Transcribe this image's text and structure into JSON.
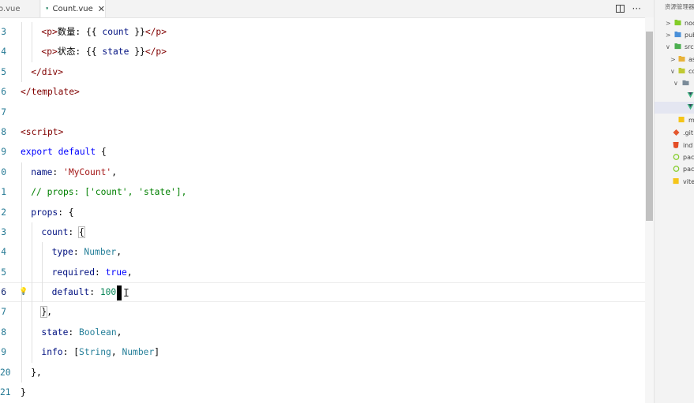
{
  "tabs": [
    {
      "label": "o.vue",
      "active": false
    },
    {
      "label": "Count.vue",
      "active": true
    }
  ],
  "tab_close_glyph": "✕",
  "tab_actions": {
    "split_icon": "split-editor-icon",
    "more_glyph": "···"
  },
  "colors": {
    "vue_green": "#41b883",
    "folder_yellow": "#e8b33b",
    "git_orange": "#e4572e",
    "html_orange": "#e44d26",
    "node_green": "#83cd29",
    "line_number": "#237893",
    "keyword_blue": "#0000ff",
    "string_red": "#a31515",
    "tag_maroon": "#800000"
  },
  "editor": {
    "lines": [
      {
        "n": "3",
        "parts": [
          [
            "t",
            "<p>"
          ],
          [
            "tpl",
            "数量: {{ "
          ],
          [
            "v",
            "count"
          ],
          [
            "tpl",
            " }}"
          ],
          [
            "t",
            "</p>"
          ]
        ]
      },
      {
        "n": "4",
        "parts": [
          [
            "t",
            "<p>"
          ],
          [
            "tpl",
            "状态: {{ "
          ],
          [
            "v",
            "state"
          ],
          [
            "tpl",
            " }}"
          ],
          [
            "t",
            "</p>"
          ]
        ]
      },
      {
        "n": "5",
        "parts": [
          [
            "t",
            "</div>"
          ]
        ]
      },
      {
        "n": "6",
        "parts": [
          [
            "t",
            "</template>"
          ]
        ]
      },
      {
        "n": "7",
        "parts": []
      },
      {
        "n": "8",
        "parts": [
          [
            "t",
            "<script>"
          ]
        ]
      },
      {
        "n": "9",
        "parts": [
          [
            "k",
            "export"
          ],
          [
            "pl",
            " "
          ],
          [
            "k",
            "default"
          ],
          [
            "pl",
            " {"
          ]
        ]
      },
      {
        "n": "0",
        "parts": [
          [
            "v",
            "name"
          ],
          [
            "pl",
            ": "
          ],
          [
            "s",
            "'MyCount'"
          ],
          [
            "pl",
            ","
          ]
        ]
      },
      {
        "n": "1",
        "parts": [
          [
            "c",
            "// props: ['count', 'state'],"
          ]
        ]
      },
      {
        "n": "2",
        "parts": [
          [
            "v",
            "props"
          ],
          [
            "pl",
            ": {"
          ]
        ]
      },
      {
        "n": "3",
        "parts": [
          [
            "v",
            "count"
          ],
          [
            "pl",
            ": "
          ],
          [
            "bb",
            "{"
          ]
        ]
      },
      {
        "n": "4",
        "parts": [
          [
            "v",
            "type"
          ],
          [
            "pl",
            ": "
          ],
          [
            "ty",
            "Number"
          ],
          [
            "pl",
            ","
          ]
        ]
      },
      {
        "n": "5",
        "parts": [
          [
            "v",
            "required"
          ],
          [
            "pl",
            ": "
          ],
          [
            "k",
            "true"
          ],
          [
            "pl",
            ","
          ]
        ]
      },
      {
        "n": "6",
        "parts": [
          [
            "v",
            "default"
          ],
          [
            "pl",
            ": "
          ],
          [
            "n",
            "100"
          ]
        ],
        "current": true
      },
      {
        "n": "7",
        "parts": [
          [
            "bb",
            "}"
          ],
          [
            "pl",
            ","
          ]
        ]
      },
      {
        "n": "8",
        "parts": [
          [
            "v",
            "state"
          ],
          [
            "pl",
            ": "
          ],
          [
            "ty",
            "Boolean"
          ],
          [
            "pl",
            ","
          ]
        ]
      },
      {
        "n": "9",
        "parts": [
          [
            "v",
            "info"
          ],
          [
            "pl",
            ": ["
          ],
          [
            "ty",
            "String"
          ],
          [
            "pl",
            ", "
          ],
          [
            "ty",
            "Number"
          ],
          [
            "pl",
            "]"
          ]
        ]
      },
      {
        "n": "20",
        "parts": [
          [
            "pl",
            "},"
          ]
        ]
      },
      {
        "n": "21",
        "parts": [
          [
            "pl",
            "}"
          ]
        ]
      }
    ],
    "ibeam_glyph": "I",
    "lightbulb_icon": "lightbulb-icon"
  },
  "explorer": {
    "title": "资源管理器",
    "items": [
      {
        "label": "node_modules",
        "chev": ">",
        "icon": "node-folder-icon"
      },
      {
        "label": "public",
        "chev": ">",
        "icon": "folder-icon"
      },
      {
        "label": "src",
        "chev": "∨",
        "icon": "src-folder-icon"
      },
      {
        "label": "assets",
        "chev": ">",
        "icon": "folder-icon"
      },
      {
        "label": "components",
        "chev": "∨",
        "icon": "components-folder-icon"
      },
      {
        "label": "",
        "chev": "∨",
        "icon": "folder-icon"
      },
      {
        "label": "",
        "chev": "",
        "icon": "vue-file-icon"
      },
      {
        "label": "",
        "chev": "",
        "icon": "vue-file-icon",
        "selected": true
      },
      {
        "label": "m",
        "chev": "",
        "icon": "js-file-icon"
      },
      {
        "label": ".git",
        "chev": "",
        "icon": "git-icon"
      },
      {
        "label": "ind",
        "chev": "",
        "icon": "html-file-icon"
      },
      {
        "label": "pac",
        "chev": "",
        "icon": "json-file-icon"
      },
      {
        "label": "pac",
        "chev": "",
        "icon": "json-file-icon"
      },
      {
        "label": "vite",
        "chev": "",
        "icon": "js-file-icon"
      }
    ]
  }
}
